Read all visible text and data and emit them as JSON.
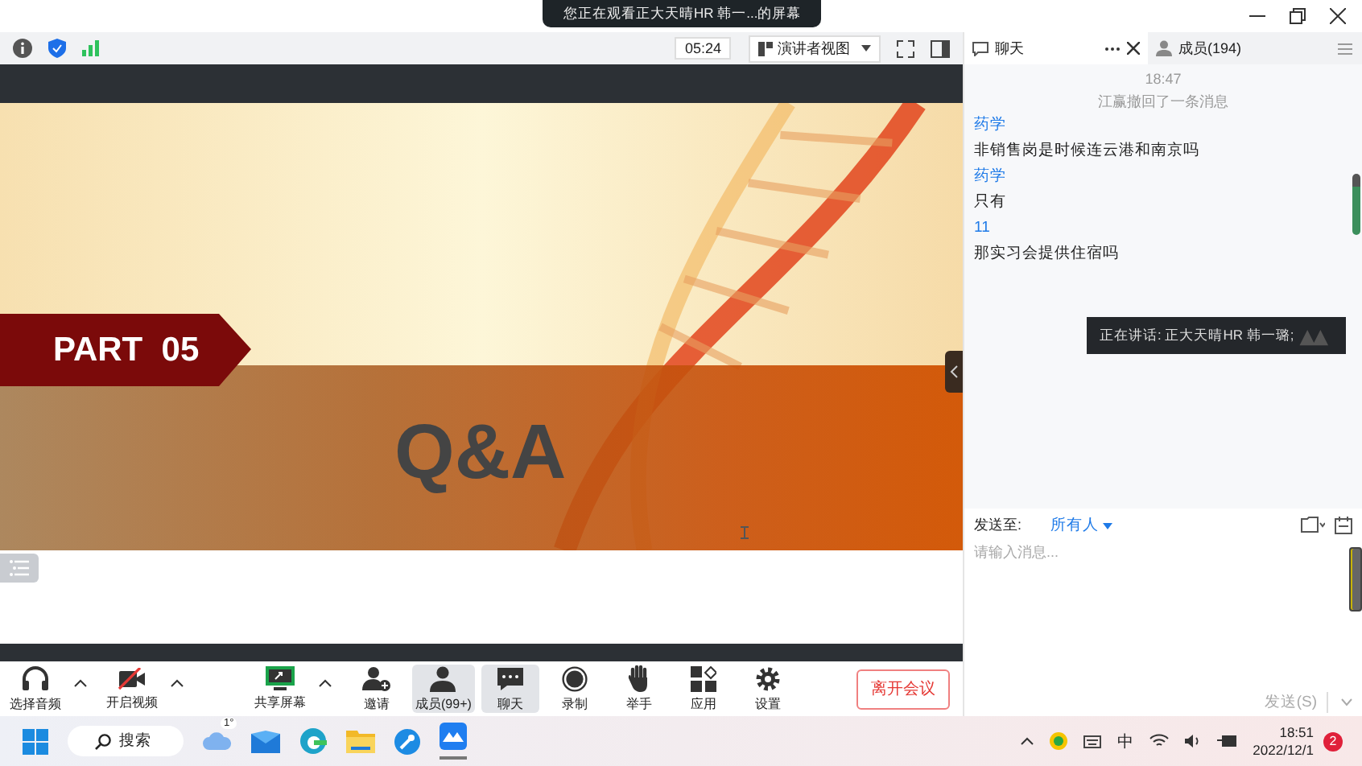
{
  "banner": {
    "text": "您正在观看正大天晴HR 韩一...的屏幕"
  },
  "toolbar": {
    "timer": "05:24",
    "view_menu": "演讲者视图"
  },
  "panel_tabs": [
    {
      "label": "聊天",
      "selected": true,
      "kind": "chat"
    },
    {
      "label": "成员(194)",
      "selected": false,
      "kind": "members"
    }
  ],
  "slide": {
    "part": "PART  05",
    "title": "Q&A"
  },
  "chat": {
    "time": "18:47",
    "notice": "江赢撤回了一条消息",
    "messages": [
      {
        "sender": "药学",
        "text": "非销售岗是时候连云港和南京吗"
      },
      {
        "sender": "药学",
        "text": "只有"
      },
      {
        "sender": "11",
        "text": "那实习会提供住宿吗"
      }
    ],
    "speaking": "正在讲话: 正大天晴HR 韩一璐;",
    "send_to_label": "发送至:",
    "send_to": "所有人",
    "placeholder": "请输入消息...",
    "send_button": "发送(S)"
  },
  "controls": [
    {
      "kind": "headset",
      "label": "选择音频",
      "caret": true,
      "selected": false
    },
    {
      "kind": "camera-off",
      "label": "开启视频",
      "caret": true,
      "selected": false
    },
    {
      "kind": "share",
      "label": "共享屏幕",
      "caret": true,
      "selected": false
    },
    {
      "kind": "invite",
      "label": "邀请",
      "caret": false,
      "selected": false
    },
    {
      "kind": "members",
      "label": "成员(99+)",
      "caret": false,
      "selected": true
    },
    {
      "kind": "chat",
      "label": "聊天",
      "caret": false,
      "selected": true
    },
    {
      "kind": "record",
      "label": "录制",
      "caret": false,
      "selected": false
    },
    {
      "kind": "hand",
      "label": "举手",
      "caret": false,
      "selected": false
    },
    {
      "kind": "apps",
      "label": "应用",
      "caret": false,
      "selected": false
    },
    {
      "kind": "gear",
      "label": "设置",
      "caret": false,
      "selected": false
    }
  ],
  "leave_button": "离开会议",
  "taskbar": {
    "weather": "1°",
    "search": "搜索",
    "ime": "中",
    "time": "18:51",
    "date": "2022/12/1",
    "notifications": "2"
  }
}
